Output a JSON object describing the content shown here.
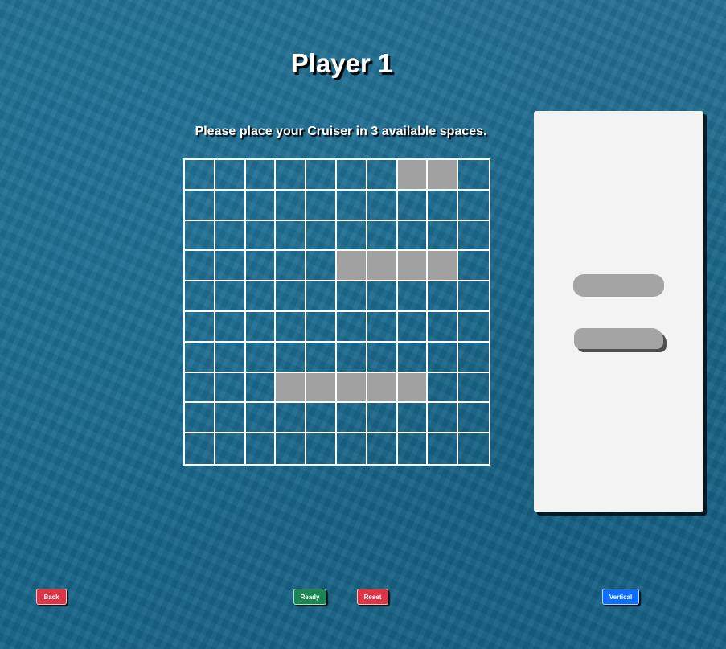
{
  "header": {
    "title": "Player 1"
  },
  "instruction": "Please place your Cruiser in 3 available spaces.",
  "board": {
    "rows": 10,
    "cols": 10,
    "ship_cells": [
      [
        0,
        7
      ],
      [
        0,
        8
      ],
      [
        3,
        5
      ],
      [
        3,
        6
      ],
      [
        3,
        7
      ],
      [
        3,
        8
      ],
      [
        7,
        3
      ],
      [
        7,
        4
      ],
      [
        7,
        5
      ],
      [
        7,
        6
      ],
      [
        7,
        7
      ]
    ]
  },
  "dock": {
    "pieces": [
      "ship-piece-top",
      "ship-piece-bottom"
    ]
  },
  "buttons": {
    "back": {
      "label": "Back",
      "color": "#dc3545"
    },
    "ready": {
      "label": "Ready",
      "color": "#198754"
    },
    "reset": {
      "label": "Reset",
      "color": "#dc3545"
    },
    "vertical": {
      "label": "Vertical",
      "color": "#0d6efd"
    }
  }
}
